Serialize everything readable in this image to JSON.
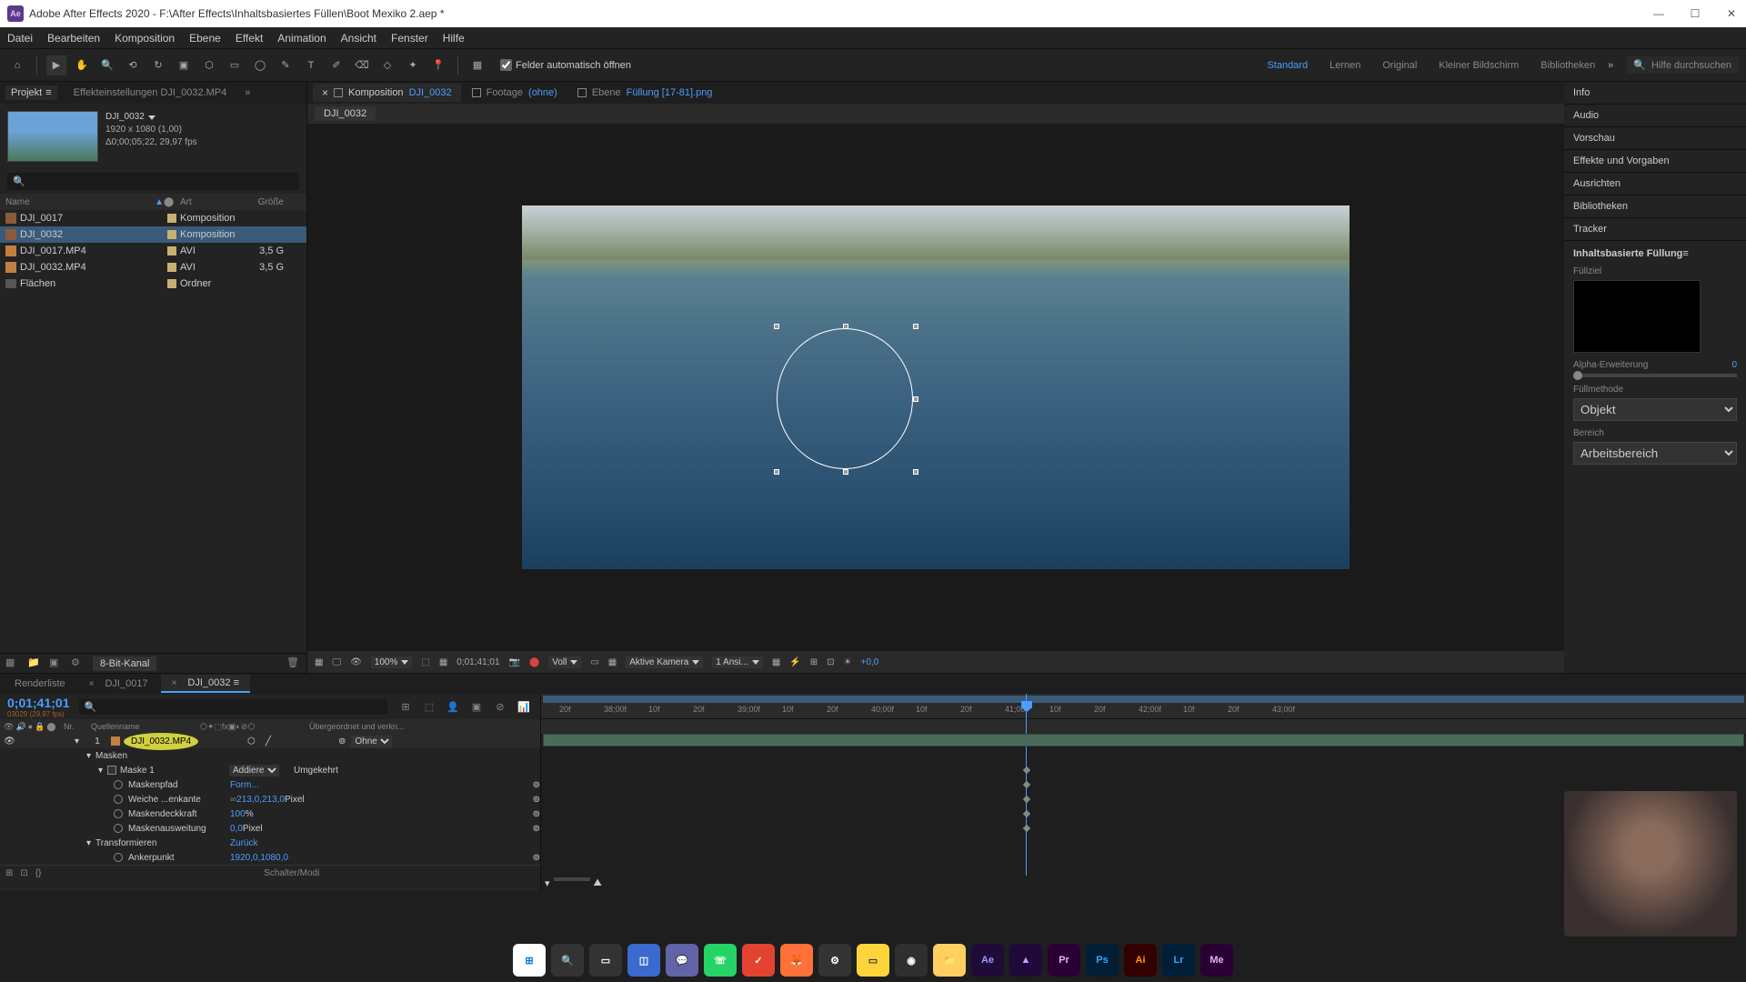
{
  "titlebar": {
    "app_name": "Adobe After Effects 2020",
    "file_path": "F:\\After Effects\\Inhaltsbasiertes Füllen\\Boot Mexiko 2.aep *"
  },
  "menubar": [
    "Datei",
    "Bearbeiten",
    "Komposition",
    "Ebene",
    "Effekt",
    "Animation",
    "Ansicht",
    "Fenster",
    "Hilfe"
  ],
  "toolbar": {
    "auto_open_label": "Felder automatisch öffnen",
    "workspaces": [
      "Standard",
      "Lernen",
      "Original",
      "Kleiner Bildschirm",
      "Bibliotheken"
    ],
    "active_workspace": "Standard",
    "search_placeholder": "Hilfe durchsuchen"
  },
  "project": {
    "tab_label": "Projekt",
    "effects_tab": "Effekteinstellungen  DJI_0032.MP4",
    "comp_name": "DJI_0032",
    "comp_dims": "1920 x 1080 (1,00)",
    "comp_duration": "Δ0;00;05;22, 29,97 fps",
    "columns": {
      "name": "Name",
      "type": "Art",
      "size": "Größe"
    },
    "items": [
      {
        "name": "DJI_0017",
        "type": "Komposition",
        "size": "",
        "icon": "comp",
        "color": "#c8b070"
      },
      {
        "name": "DJI_0032",
        "type": "Komposition",
        "size": "",
        "icon": "comp",
        "color": "#c8b070",
        "selected": true
      },
      {
        "name": "DJI_0017.MP4",
        "type": "AVI",
        "size": "3,5 G",
        "icon": "vid",
        "color": "#c8b070"
      },
      {
        "name": "DJI_0032.MP4",
        "type": "AVI",
        "size": "3,5 G",
        "icon": "vid",
        "color": "#c8b070"
      },
      {
        "name": "Flächen",
        "type": "Ordner",
        "size": "",
        "icon": "folder",
        "color": "#c8b070"
      }
    ],
    "footer_depth": "8-Bit-Kanal"
  },
  "composition": {
    "tabs": [
      {
        "prefix": "Komposition",
        "name": "DJI_0032",
        "active": true
      },
      {
        "prefix": "Footage",
        "name": "(ohne)",
        "active": false
      },
      {
        "prefix": "Ebene",
        "name": "Füllung  [17-81].png",
        "active": false
      }
    ],
    "breadcrumb": "DJI_0032",
    "footer": {
      "zoom": "100%",
      "timecode": "0;01;41;01",
      "resolution": "Voll",
      "camera": "Aktive Kamera",
      "views": "1 Ansi...",
      "exposure": "+0,0"
    }
  },
  "right_panels": [
    "Info",
    "Audio",
    "Vorschau",
    "Effekte und Vorgaben",
    "Ausrichten",
    "Bibliotheken",
    "Tracker"
  ],
  "caf": {
    "title": "Inhaltsbasierte Füllung",
    "fill_target": "Füllziel",
    "alpha_label": "Alpha-Erweiterung",
    "alpha_value": "0",
    "method_label": "Füllmethode",
    "method_value": "Objekt",
    "range_label": "Bereich",
    "range_value": "Arbeitsbereich"
  },
  "timeline": {
    "tabs": [
      {
        "label": "Renderliste",
        "active": false
      },
      {
        "label": "DJI_0017",
        "active": false,
        "closable": true
      },
      {
        "label": "DJI_0032",
        "active": true,
        "closable": true
      }
    ],
    "timecode": "0;01;41;01",
    "subframe": "03029 (29,97 fps)",
    "columns": {
      "nr": "Nr.",
      "name": "Quellenname",
      "parent": "Übergeordnet und verkn..."
    },
    "layer": {
      "index": "1",
      "name": "DJI_0032.MP4",
      "parent_label": "Ohne",
      "masks_group": "Masken",
      "mask_name": "Maske 1",
      "mask_mode": "Addiere",
      "mask_invert": "Umgekehrt",
      "props": [
        {
          "name": "Maskenpfad",
          "value": "Form...",
          "link": false
        },
        {
          "name": "Weiche ...enkante",
          "value": "213,0,213,0",
          "unit": "Pixel",
          "link": true
        },
        {
          "name": "Maskendeckkraft",
          "value": "100",
          "unit": "%",
          "link": false
        },
        {
          "name": "Maskenausweitung",
          "value": "0,0",
          "unit": "Pixel",
          "link": false
        }
      ],
      "transform_group": "Transformieren",
      "transform_reset": "Zurück",
      "anchor": "Ankerpunkt",
      "anchor_value": "1920,0,1080,0"
    },
    "footer_label": "Schalter/Modi",
    "ruler_ticks": [
      "20f",
      "38;00f",
      "10f",
      "20f",
      "39;00f",
      "10f",
      "20f",
      "40;00f",
      "10f",
      "20f",
      "41;00f",
      "10f",
      "20f",
      "42;00f",
      "10f",
      "20f",
      "43;00f"
    ]
  },
  "taskbar_apps": [
    {
      "name": "windows",
      "bg": "#ffffff",
      "fg": "#0078d4",
      "label": "⊞"
    },
    {
      "name": "search",
      "bg": "#333333",
      "fg": "#ffffff",
      "label": "🔍"
    },
    {
      "name": "task-view",
      "bg": "#333333",
      "fg": "#ffffff",
      "label": "▭"
    },
    {
      "name": "widgets",
      "bg": "#3a6ad0",
      "fg": "#ffffff",
      "label": "◫"
    },
    {
      "name": "teams",
      "bg": "#6264a7",
      "fg": "#ffffff",
      "label": "💬"
    },
    {
      "name": "whatsapp",
      "bg": "#25d366",
      "fg": "#ffffff",
      "label": "☏"
    },
    {
      "name": "todoist",
      "bg": "#e44332",
      "fg": "#ffffff",
      "label": "✓"
    },
    {
      "name": "firefox",
      "bg": "#ff7139",
      "fg": "#ffffff",
      "label": "🦊"
    },
    {
      "name": "app1",
      "bg": "#333333",
      "fg": "#ffffff",
      "label": "⚙"
    },
    {
      "name": "notes",
      "bg": "#ffd43b",
      "fg": "#333333",
      "label": "▭"
    },
    {
      "name": "obs",
      "bg": "#302e31",
      "fg": "#ffffff",
      "label": "◉"
    },
    {
      "name": "explorer",
      "bg": "#ffd060",
      "fg": "#333333",
      "label": "📁"
    },
    {
      "name": "ae",
      "bg": "#1f0a3a",
      "fg": "#9a9aff",
      "label": "Ae"
    },
    {
      "name": "ame",
      "bg": "#1f0a3a",
      "fg": "#c9a0ff",
      "label": "▲"
    },
    {
      "name": "pr",
      "bg": "#2a0034",
      "fg": "#e6adff",
      "label": "Pr"
    },
    {
      "name": "ps",
      "bg": "#001e36",
      "fg": "#31a8ff",
      "label": "Ps"
    },
    {
      "name": "ai",
      "bg": "#330000",
      "fg": "#ff9a00",
      "label": "Ai"
    },
    {
      "name": "lr",
      "bg": "#001e36",
      "fg": "#31a8ff",
      "label": "Lr"
    },
    {
      "name": "me",
      "bg": "#2a0034",
      "fg": "#e6adff",
      "label": "Me"
    }
  ]
}
